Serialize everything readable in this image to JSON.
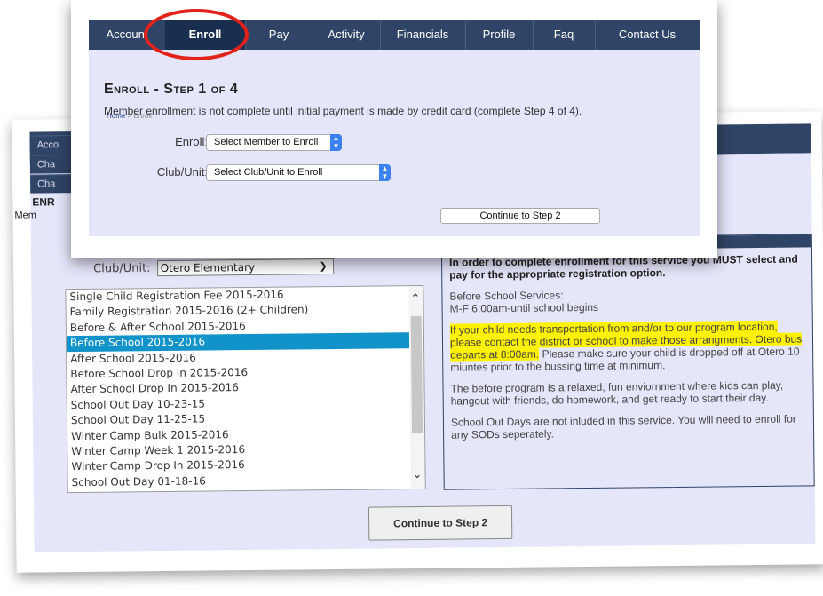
{
  "back": {
    "nav_labels": [
      "Acco",
      "Cha",
      "Cha"
    ],
    "title_fragment": "ENR",
    "sub_fragment": "Mem",
    "club_label": "Club/Unit:",
    "club_value": "Otero Elementary",
    "list_items": [
      "Single Child Registration Fee 2015-2016",
      "Family Registration 2015-2016 (2+ Children)",
      "Before & After School 2015-2016",
      "Before School 2015-2016",
      "After School 2015-2016",
      "Before School Drop In 2015-2016",
      "After School Drop In 2015-2016",
      "School Out Day 10-23-15",
      "School Out Day 11-25-15",
      "Winter Camp Bulk 2015-2016",
      "Winter Camp Week 1 2015-2016",
      "Winter Camp Drop In 2015-2016",
      "School Out Day 01-18-16"
    ],
    "info_lead": "In order to complete enrollment for this service you MUST select and pay for the appropriate registration option.",
    "info_services_1": "Before School Services:",
    "info_services_2": "M-F 6:00am-until school begins",
    "info_transport_highlight": "If your child needs transportation from and/or to our program location, please contact the district or school to make those arrangments. Otero bus departs at 8:00am.",
    "info_transport_rest": " Please make sure your child is dropped off at Otero 10 miuntes prior to the bussing time at minimum.",
    "info_program": "The before program is a relaxed, fun enviornment where kids can play, hangout with friends, do homework, and get ready to start their day.",
    "info_sod": "School Out Days are not inluded in this service. You will need to enroll for any SODs seperately.",
    "continue_label": "Continue to Step 2"
  },
  "front": {
    "nav": [
      "Account",
      "Enroll",
      "Pay",
      "Activity",
      "Financials",
      "Profile",
      "Faq",
      "Contact Us"
    ],
    "breadcrumb_home": "Home",
    "breadcrumb_sep": " > ",
    "breadcrumb_current": "Enroll",
    "title": "Enroll - Step 1 of 4",
    "subtitle": "Member enrollment is not complete until initial payment is made by credit card (complete Step 4 of 4).",
    "enroll_label": "Enroll:",
    "enroll_value": "Select Member to Enroll",
    "club_label": "Club/Unit:",
    "club_value": "Select Club/Unit to Enroll",
    "continue_label": "Continue to Step 2"
  },
  "colors": {
    "nav": "#2f4466",
    "panel": "#e6e6fb",
    "selected": "#1192c9",
    "highlight": "#fff200",
    "annotation": "#e2231a"
  }
}
